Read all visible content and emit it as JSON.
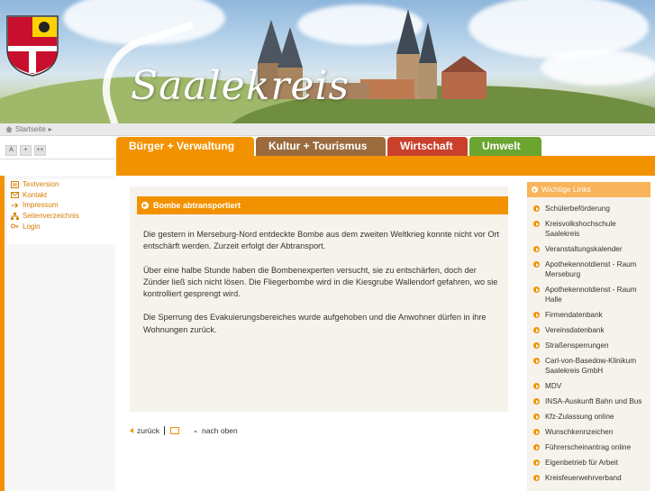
{
  "banner": {
    "title": "Saalekreis"
  },
  "breadcrumb": {
    "home": "Startseite",
    "separator": "▸"
  },
  "font_controls": [
    "A",
    "+",
    "++"
  ],
  "tabs": [
    {
      "label": "Bürger + Verwaltung",
      "color": "#f39200"
    },
    {
      "label": "Kultur + Tourismus",
      "color": "#9b6b3d"
    },
    {
      "label": "Wirtschaft",
      "color": "#c9402b"
    },
    {
      "label": "Umwelt",
      "color": "#6aa52f"
    }
  ],
  "left_menu": [
    {
      "label": "Textversion",
      "icon": "text-version-icon"
    },
    {
      "label": "Kontakt",
      "icon": "mail-icon"
    },
    {
      "label": "Impressum",
      "icon": "arrow-right-icon"
    },
    {
      "label": "Seitenverzeichnis",
      "icon": "sitemap-icon"
    },
    {
      "label": "Login",
      "icon": "key-icon"
    }
  ],
  "article": {
    "title": "Bombe abtransportiert",
    "paragraphs": [
      "Die gestern in Merseburg-Nord entdeckte Bombe aus dem zweiten Weltkrieg konnte nicht vor Ort entschärft werden. Zurzeit erfolgt der Abtransport.",
      "Über eine halbe Stunde haben die Bombenexperten versucht, sie zu entschärfen, doch der Zünder ließ sich nicht lösen. Die Fliegerbombe wird in die Kiesgrube Wallendorf gefahren, wo sie kontrolliert gesprengt wird.",
      "Die Sperrung des Evakuierungsbereiches wurde aufgehoben und die Anwohner dürfen in ihre Wohnungen zurück."
    ]
  },
  "bottom_nav": {
    "back": "zurück",
    "top": "nach oben"
  },
  "right_sidebar": {
    "heading": "Wichtige Links",
    "links": [
      [
        "Schülerbeförderung"
      ],
      [
        "Kreisvolkshochschule",
        "Saalekreis"
      ],
      [
        "Veranstaltungskalender"
      ],
      [
        "Apothekennotdienst - Raum",
        "Merseburg"
      ],
      [
        "Apothekennotdienst - Raum",
        "Halle"
      ],
      [
        "Firmendatenbank"
      ],
      [
        "Vereinsdatenbank"
      ],
      [
        "Straßensperrungen"
      ],
      [
        "Carl-von-Basedow-Klinikum",
        "Saalekreis GmbH"
      ],
      [
        "MDV"
      ],
      [
        "INSA-Auskunft Bahn und Bus"
      ],
      [
        "Kfz-Zulassung online"
      ],
      [
        "Wunschkennzeichen"
      ],
      [
        "Führerscheinantrag online"
      ],
      [
        "Eigenbetrieb für Arbeit"
      ],
      [
        "Kreisfeuerwehrverband"
      ]
    ]
  },
  "colors": {
    "accent_orange": "#f39200",
    "light_orange": "#f7b45b",
    "content_bg": "#f6f3ec"
  }
}
